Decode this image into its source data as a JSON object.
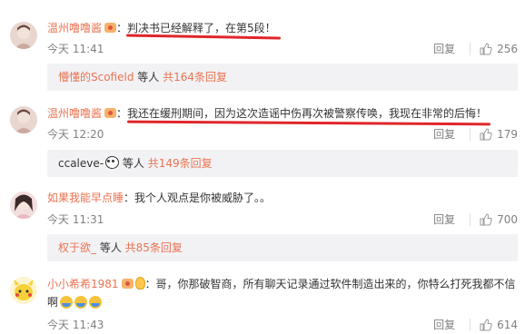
{
  "comments": [
    {
      "username": "温州噜噜酱",
      "text": "：判决书已经解释了，在第5段！",
      "time": "今天 11:41",
      "reply_label": "回复",
      "likes": "256",
      "sub": {
        "who": "懵懂的Scofield",
        "mid": " 等人 ",
        "count": "共164条回复"
      }
    },
    {
      "username": "温州噜噜酱",
      "text": "：我还在缓刑期间，因为这次造谣中伤再次被警察传唤，我现在非常的后悔！",
      "time": "今天 12:20",
      "reply_label": "回复",
      "likes": "179",
      "sub": {
        "who": "ccaleve-",
        "mid": " 等人 ",
        "count": "共149条回复"
      }
    },
    {
      "username": "如果我能早点睡",
      "text": "：我个人观点是你被威胁了。。",
      "time": "今天 11:31",
      "reply_label": "回复",
      "likes": "700",
      "sub": {
        "who": "权于欲_",
        "mid": " 等人 ",
        "count": "共85条回复"
      }
    },
    {
      "username": "小小希希1981",
      "text": "：哥，你那破智商，所有聊天记录通过软件制造出来的，你特么打死我都不信",
      "text2": "啊",
      "time": "今天 11:43",
      "reply_label": "回复",
      "likes": "614"
    }
  ],
  "colors": {
    "username": "#eb7350",
    "underline": "#e0262b",
    "meta": "#808080",
    "subpanel": "#f2f2f5"
  },
  "icons": {
    "like": "thumbs-up-icon",
    "vip_badge": "vip-badge-icon",
    "panda": "panda-emoji-icon",
    "laugh": "laugh-cry-emoji-icon"
  }
}
